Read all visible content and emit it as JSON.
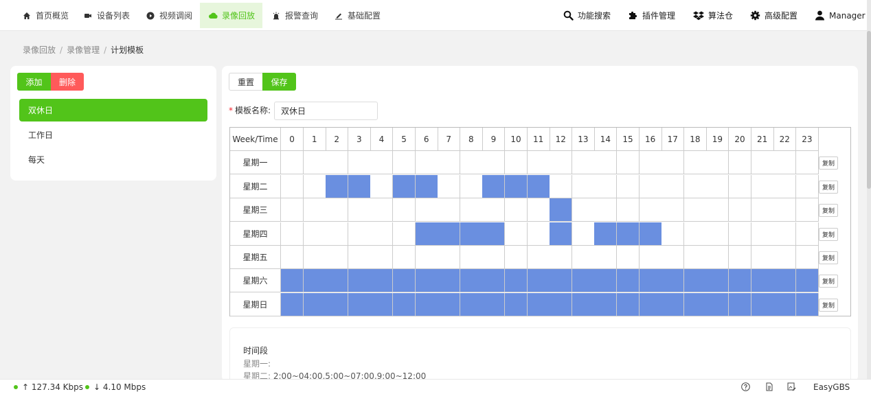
{
  "nav": {
    "items": [
      {
        "label": "首页概览",
        "icon": "home-icon",
        "active": false
      },
      {
        "label": "设备列表",
        "icon": "video-camera-icon",
        "active": false
      },
      {
        "label": "视频调阅",
        "icon": "play-circle-icon",
        "active": false
      },
      {
        "label": "录像回放",
        "icon": "cloud-icon",
        "active": true
      },
      {
        "label": "报警查询",
        "icon": "alarm-icon",
        "active": false
      },
      {
        "label": "基础配置",
        "icon": "edit-icon",
        "active": false
      }
    ],
    "right": [
      {
        "label": "功能搜索",
        "icon": "search-icon"
      },
      {
        "label": "插件管理",
        "icon": "puzzle-icon"
      },
      {
        "label": "算法仓",
        "icon": "dropbox-icon"
      },
      {
        "label": "高级配置",
        "icon": "gear-icon"
      },
      {
        "label": "Manager",
        "icon": "user-icon"
      }
    ]
  },
  "breadcrumb": [
    "录像回放",
    "录像管理",
    "计划模板"
  ],
  "left": {
    "add_label": "添加",
    "delete_label": "删除",
    "templates": [
      "双休日",
      "工作日",
      "每天"
    ],
    "selected": 0
  },
  "right": {
    "reset_label": "重置",
    "save_label": "保存",
    "name_label": "模板名称:",
    "name_value": "双休日",
    "copy_label": "复制",
    "grid": {
      "header": "Week/Time",
      "hours": [
        "0",
        "1",
        "2",
        "3",
        "4",
        "5",
        "6",
        "7",
        "8",
        "9",
        "10",
        "11",
        "12",
        "13",
        "14",
        "15",
        "16",
        "17",
        "18",
        "19",
        "20",
        "21",
        "22",
        "23"
      ],
      "days": [
        {
          "name": "星期一",
          "on": []
        },
        {
          "name": "星期二",
          "on": [
            2,
            3,
            5,
            6,
            9,
            10,
            11
          ]
        },
        {
          "name": "星期三",
          "on": [
            12
          ]
        },
        {
          "name": "星期四",
          "on": [
            6,
            7,
            8,
            9,
            12,
            14,
            15,
            16
          ]
        },
        {
          "name": "星期五",
          "on": []
        },
        {
          "name": "星期六",
          "on": [
            0,
            1,
            2,
            3,
            4,
            5,
            6,
            7,
            8,
            9,
            10,
            11,
            12,
            13,
            14,
            15,
            16,
            17,
            18,
            19,
            20,
            21,
            22,
            23
          ]
        },
        {
          "name": "星期日",
          "on": [
            0,
            1,
            2,
            3,
            4,
            5,
            6,
            7,
            8,
            9,
            10,
            11,
            12,
            13,
            14,
            15,
            16,
            17,
            18,
            19,
            20,
            21,
            22,
            23
          ]
        }
      ]
    },
    "periods": {
      "title": "时间段",
      "lines": [
        {
          "day": "星期一:",
          "value": ""
        },
        {
          "day": "星期二:",
          "value": "2:00~04:00,5:00~07:00,9:00~12:00"
        }
      ]
    }
  },
  "status": {
    "upload": "↑ 127.34 Kbps",
    "download": "↓ 4.10 Mbps",
    "brand": "EasyGBS",
    "accent": "#52c41a",
    "selected_slot_color": "#6a8fe0"
  }
}
